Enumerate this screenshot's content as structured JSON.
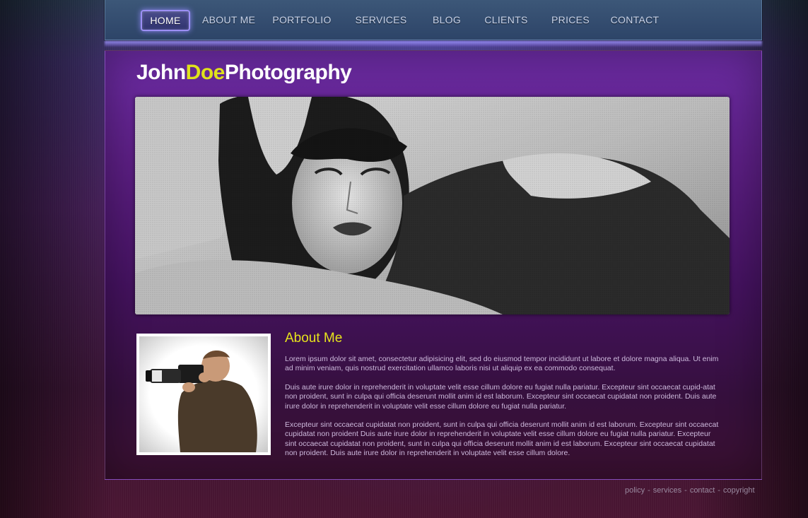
{
  "nav": {
    "items": [
      {
        "label": "HOME",
        "active": true
      },
      {
        "label": "ABOUT ME",
        "active": false
      },
      {
        "label": "PORTFOLIO",
        "active": false
      },
      {
        "label": "SERVICES",
        "active": false
      },
      {
        "label": "BLOG",
        "active": false
      },
      {
        "label": "CLIENTS",
        "active": false
      },
      {
        "label": "PRICES",
        "active": false
      },
      {
        "label": "CONTACT",
        "active": false
      }
    ]
  },
  "logo": {
    "part1": "John",
    "part2": "Doe",
    "part3": "Photography",
    "accent_color": "#dfe21b"
  },
  "about": {
    "title": "About Me",
    "paragraphs": [
      "Lorem ipsum dolor sit amet, consectetur adipisicing elit, sed do eiusmod tempor incididunt ut labore et dolore magna aliqua. Ut enim ad minim veniam, quis nostrud exercitation ullamco laboris nisi ut aliquip ex ea commodo consequat.",
      "Duis aute irure dolor in reprehenderit in voluptate velit esse cillum dolore eu fugiat nulla pariatur. Excepteur sint occaecat cupid-atat non proident, sunt in culpa qui officia deserunt mollit anim id est laborum. Excepteur sint occaecat cupidatat non proident. Duis aute irure dolor in reprehenderit in voluptate velit esse cillum dolore eu fugiat nulla pariatur.",
      " Excepteur sint occaecat cupidatat non proident, sunt in culpa qui officia deserunt mollit anim id est laborum. Excepteur sint occaecat cupidatat non proident Duis aute irure dolor in reprehenderit in voluptate velit esse cillum dolore eu fugiat nulla pariatur. Excepteur sint occaecat cupidatat non proident, sunt in culpa qui officia deserunt mollit anim id est laborum. Excepteur sint occaecat cupidatat non proident. Duis aute irure dolor in reprehenderit in voluptate velit esse cillum dolore."
    ]
  },
  "footer": {
    "links": [
      "policy",
      "services",
      "contact",
      "copyright"
    ],
    "separator": "-"
  },
  "colors": {
    "accent": "#e6e31c",
    "nav_active_border": "#9c8ff5"
  }
}
